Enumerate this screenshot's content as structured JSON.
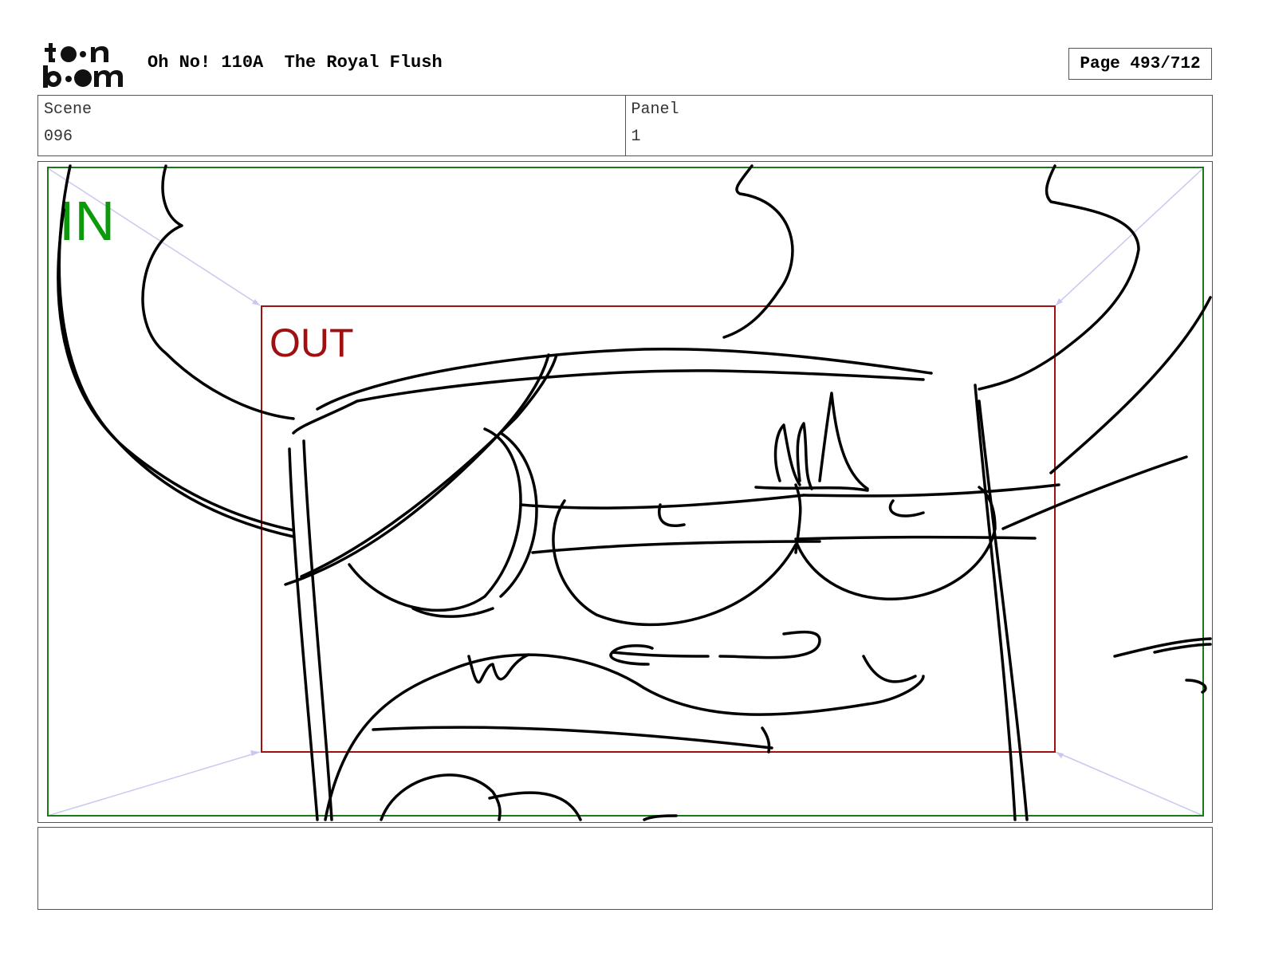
{
  "header": {
    "logo_text": "toon boom",
    "title": "Oh No! 110A  The Royal Flush",
    "page": "Page 493/712"
  },
  "info": {
    "scene_label": "Scene",
    "scene_value": "096",
    "panel_label": "Panel",
    "panel_value": "1"
  },
  "frame": {
    "in_label": "IN",
    "out_label": "OUT",
    "in_color": "#0a9a0a",
    "out_color": "#a01010"
  },
  "caption": {
    "text": ""
  }
}
